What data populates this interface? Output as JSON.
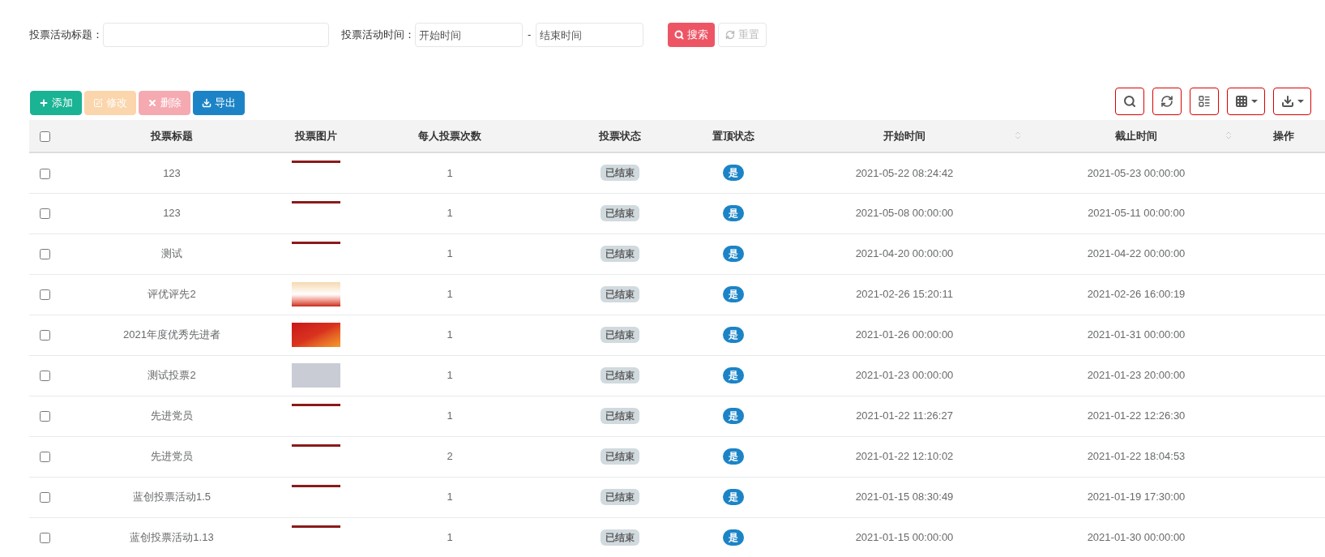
{
  "search": {
    "title_label": "投票活动标题：",
    "time_label": "投票活动时间：",
    "start_placeholder": "开始时间",
    "separator": "-",
    "end_placeholder": "结束时间",
    "search_button": "搜索",
    "reset_button": "重置"
  },
  "actions": [
    {
      "kind": "add",
      "label": "添加",
      "disabled": false
    },
    {
      "kind": "edit",
      "label": "修改",
      "disabled": true
    },
    {
      "kind": "delete",
      "label": "删除",
      "disabled": true
    },
    {
      "kind": "export",
      "label": "导出",
      "disabled": false
    }
  ],
  "tools": [
    {
      "kind": "search"
    },
    {
      "kind": "refresh"
    },
    {
      "kind": "toggle"
    },
    {
      "kind": "columns"
    },
    {
      "kind": "export"
    }
  ],
  "table": {
    "all_checked": false,
    "columns": [
      {
        "label": "投票标题",
        "sortable": false
      },
      {
        "label": "投票图片",
        "sortable": false
      },
      {
        "label": "每人投票次数",
        "sortable": false
      },
      {
        "label": "投票状态",
        "sortable": false
      },
      {
        "label": "置顶状态",
        "sortable": false
      },
      {
        "label": "开始时间",
        "sortable": true
      },
      {
        "label": "截止时间",
        "sortable": true
      },
      {
        "label": "操作",
        "sortable": false
      }
    ],
    "rows": [
      {
        "checked": false,
        "title": "123",
        "image": {
          "kind": "strip"
        },
        "count": "1",
        "status": "已结束",
        "top": "是",
        "start": "2021-05-22 08:24:42",
        "end": "2021-05-23 00:00:00"
      },
      {
        "checked": false,
        "title": "123",
        "image": {
          "kind": "strip"
        },
        "count": "1",
        "status": "已结束",
        "top": "是",
        "start": "2021-05-08 00:00:00",
        "end": "2021-05-11 00:00:00"
      },
      {
        "checked": false,
        "title": "测试",
        "image": {
          "kind": "strip"
        },
        "count": "1",
        "status": "已结束",
        "top": "是",
        "start": "2021-04-20 00:00:00",
        "end": "2021-04-22 00:00:00"
      },
      {
        "checked": false,
        "title": "评优评先2",
        "image": {
          "kind": "festive"
        },
        "count": "1",
        "status": "已结束",
        "top": "是",
        "start": "2021-02-26 15:20:11",
        "end": "2021-02-26 16:00:19"
      },
      {
        "checked": false,
        "title": "2021年度优秀先进者",
        "image": {
          "kind": "red"
        },
        "count": "1",
        "status": "已结束",
        "top": "是",
        "start": "2021-01-26 00:00:00",
        "end": "2021-01-31 00:00:00"
      },
      {
        "checked": false,
        "title": "测试投票2",
        "image": {
          "kind": "gray"
        },
        "count": "1",
        "status": "已结束",
        "top": "是",
        "start": "2021-01-23 00:00:00",
        "end": "2021-01-23 20:00:00"
      },
      {
        "checked": false,
        "title": "先进党员",
        "image": {
          "kind": "strip"
        },
        "count": "1",
        "status": "已结束",
        "top": "是",
        "start": "2021-01-22 11:26:27",
        "end": "2021-01-22 12:26:30"
      },
      {
        "checked": false,
        "title": "先进党员",
        "image": {
          "kind": "strip"
        },
        "count": "2",
        "status": "已结束",
        "top": "是",
        "start": "2021-01-22 12:10:02",
        "end": "2021-01-22 18:04:53"
      },
      {
        "checked": false,
        "title": "蓝创投票活动1.5",
        "image": {
          "kind": "strip"
        },
        "count": "1",
        "status": "已结束",
        "top": "是",
        "start": "2021-01-15 08:30:49",
        "end": "2021-01-19 17:30:00"
      },
      {
        "checked": false,
        "title": "蓝创投票活动1.13",
        "image": {
          "kind": "strip"
        },
        "count": "1",
        "status": "已结束",
        "top": "是",
        "start": "2021-01-15 00:00:00",
        "end": "2021-01-30 00:00:00"
      }
    ]
  }
}
